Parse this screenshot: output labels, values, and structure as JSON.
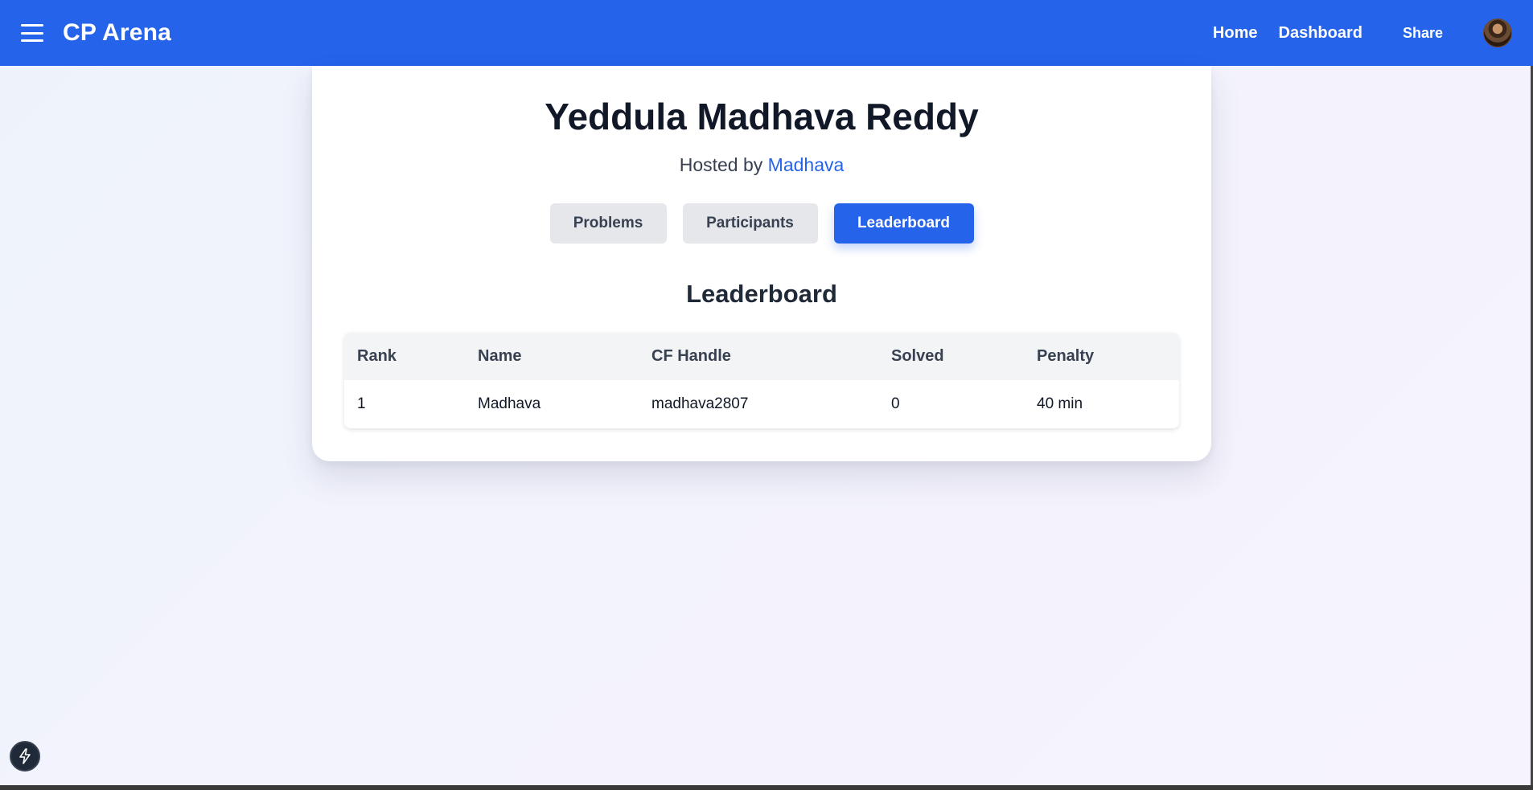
{
  "navbar": {
    "brand": "CP Arena",
    "links": {
      "home": "Home",
      "dashboard": "Dashboard",
      "share": "Share"
    },
    "color": "#2563eb"
  },
  "contest": {
    "title": "Yeddula Madhava Reddy",
    "hosted_prefix": "Hosted by",
    "host_name": "Madhava"
  },
  "tabs": {
    "problems": "Problems",
    "participants": "Participants",
    "leaderboard": "Leaderboard",
    "active": "leaderboard"
  },
  "leaderboard": {
    "heading": "Leaderboard",
    "columns": [
      "Rank",
      "Name",
      "CF Handle",
      "Solved",
      "Penalty"
    ],
    "rows": [
      {
        "rank": "1",
        "name": "Madhava",
        "handle": "madhava2807",
        "solved": "0",
        "penalty": "40 min"
      }
    ]
  },
  "icons": {
    "menu": "hamburger-menu-icon",
    "avatar": "user-avatar",
    "floating": "lightning-bolt-icon"
  }
}
